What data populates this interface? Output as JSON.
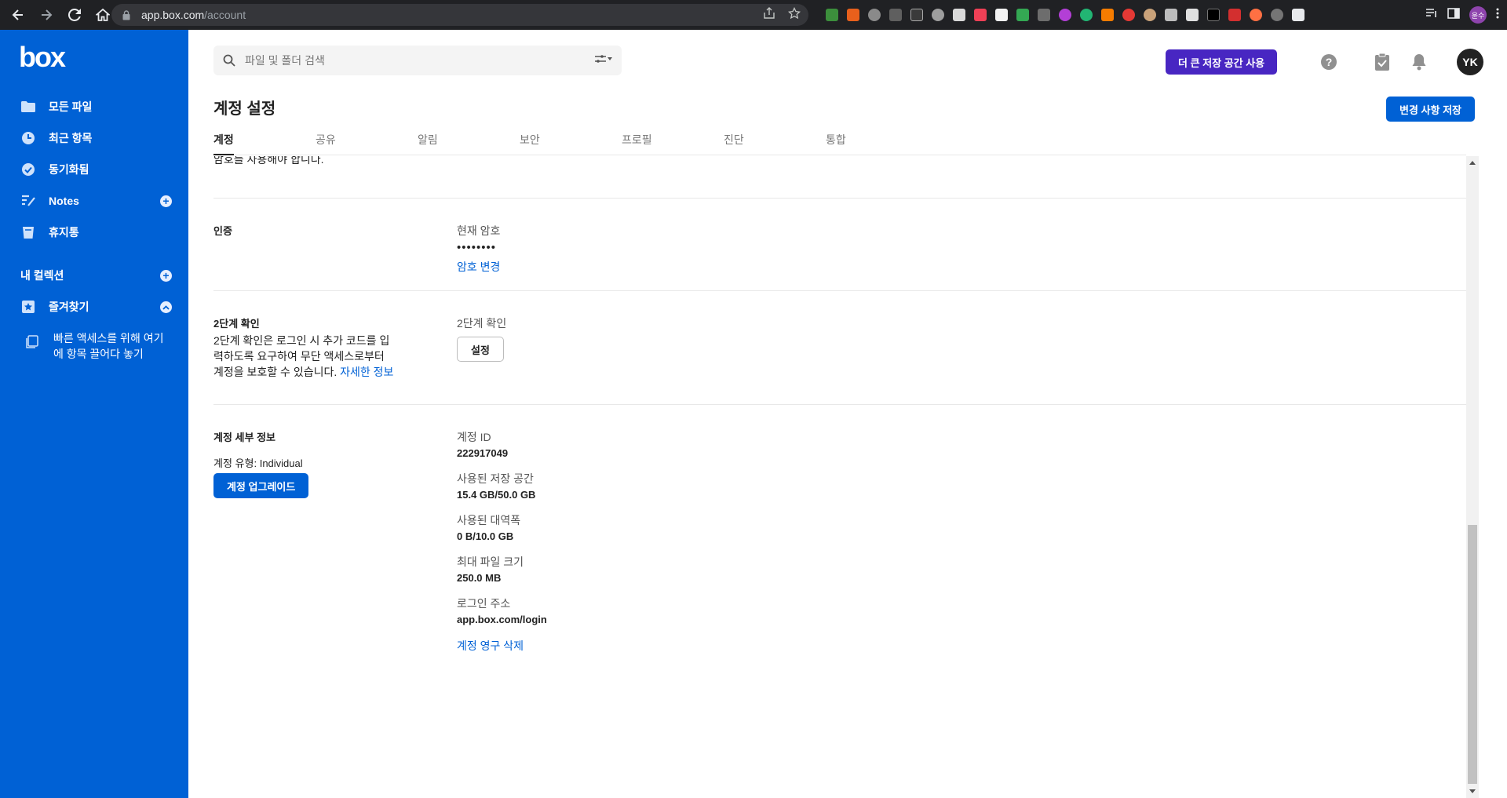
{
  "browser": {
    "url_host": "app.box.com",
    "url_path": "/account",
    "profile_label": "윤수"
  },
  "sidebar": {
    "logo_text": "box",
    "items": [
      {
        "label": "모든 파일",
        "icon": "folder-icon"
      },
      {
        "label": "최근 항목",
        "icon": "clock-icon"
      },
      {
        "label": "동기화됨",
        "icon": "check-circle-icon"
      },
      {
        "label": "Notes",
        "icon": "notes-icon"
      },
      {
        "label": "휴지통",
        "icon": "trash-icon"
      }
    ],
    "collections_label": "내 컬렉션",
    "favorites_label": "즐겨찾기",
    "quick_access_text": "빠른 액세스를 위해 여기에 항목 끌어다 놓기"
  },
  "header": {
    "search_placeholder": "파일 및 폴더 검색",
    "upgrade_storage_label": "더 큰 저장 공간 사용",
    "avatar_initials": "YK"
  },
  "page": {
    "title": "계정 설정",
    "save_label": "변경 사항 저장",
    "tabs": [
      "계정",
      "공유",
      "알림",
      "보안",
      "프로필",
      "진단",
      "통합"
    ],
    "active_tab": "계정"
  },
  "content": {
    "cut_off_text": "암호를 사용해야 합니다.",
    "auth": {
      "title": "인증",
      "current_password_label": "현재 암호",
      "password_mask": "••••••••",
      "change_password_link": "암호 변경"
    },
    "two_step": {
      "title": "2단계 확인",
      "description": "2단계 확인은 로그인 시 추가 코드를 입력하도록 요구하여 무단 액세스로부터 계정을 보호할 수 있습니다.",
      "learn_more": "자세한 정보",
      "field_label": "2단계 확인",
      "setup_label": "설정"
    },
    "details": {
      "title": "계정 세부 정보",
      "account_type_label": "계정 유형:",
      "account_type_value": "Individual",
      "upgrade_account_label": "계정 업그레이드",
      "fields": [
        {
          "label": "계정 ID",
          "value": "222917049"
        },
        {
          "label": "사용된 저장 공간",
          "value": "15.4 GB/50.0 GB"
        },
        {
          "label": "사용된 대역폭",
          "value": "0 B/10.0 GB"
        },
        {
          "label": "최대 파일 크기",
          "value": "250.0 MB"
        },
        {
          "label": "로그인 주소",
          "value": "app.box.com/login"
        }
      ],
      "delete_account_link": "계정 영구 삭제"
    }
  },
  "colors": {
    "brand_blue": "#0061d5",
    "upgrade_purple": "#4826c2"
  }
}
